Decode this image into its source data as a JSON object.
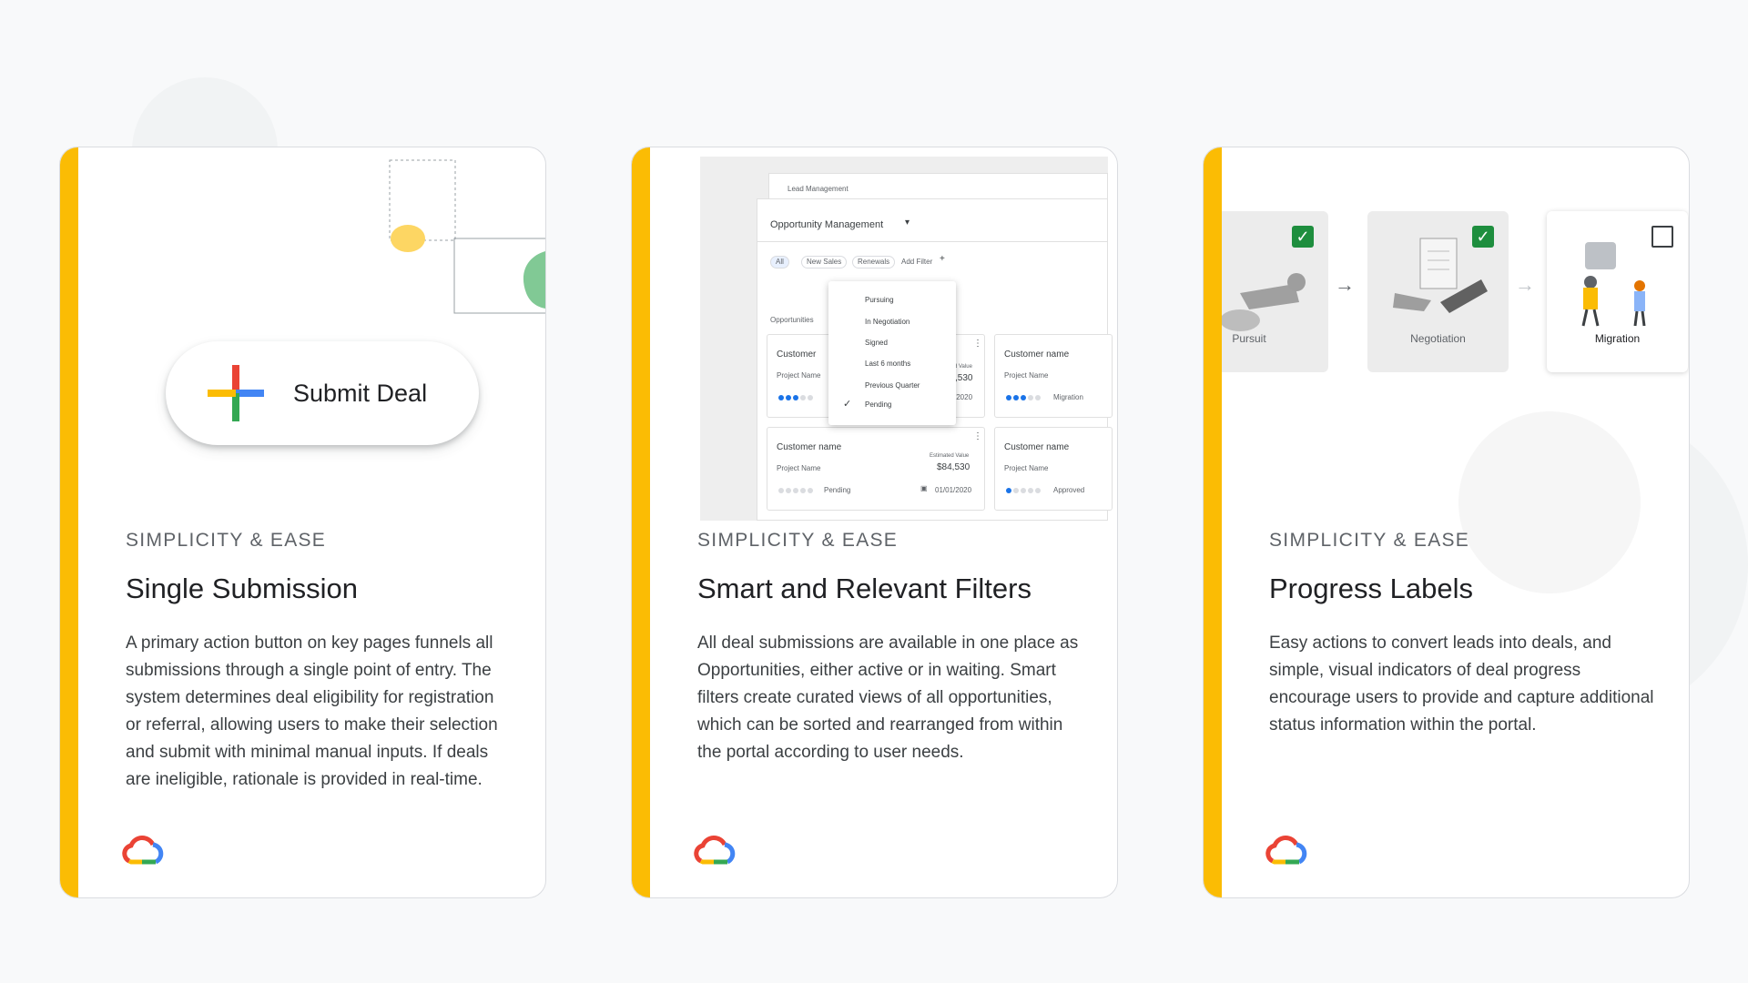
{
  "colors": {
    "accent_bar": "#fbbc04",
    "background": "#f8f9fa",
    "google_blue": "#4285f4",
    "google_red": "#ea4335",
    "google_yellow": "#fbbc04",
    "google_green": "#34a853",
    "check_green": "#1e8e3e"
  },
  "cards": [
    {
      "eyebrow": "SIMPLICITY & EASE",
      "title": "Single Submission",
      "body": "A primary action button on key pages funnels all submissions through a single point of entry. The system determines deal eligibility for registration or referral, allowing users to make their selection and submit with minimal manual inputs. If deals are ineligible, rationale is provided in real-time.",
      "logo_icon": "google-cloud-logo-icon",
      "illustration": {
        "fab_label": "Submit Deal",
        "fab_icon": "plus-icon"
      }
    },
    {
      "eyebrow": "SIMPLICITY & EASE",
      "title": "Smart and Relevant Filters",
      "body": "All deal submissions are available in one place as Opportunities, either active or in waiting. Smart filters create curated views of all opportunities, which can be sorted and rearranged from within the portal according to user needs.",
      "logo_icon": "google-cloud-logo-icon",
      "illustration": {
        "back_window_title": "Lead Management",
        "dropdown_label": "Opportunity Management",
        "chips": [
          "All",
          "New Sales",
          "Renewals",
          "Add Filter"
        ],
        "section_label": "Opportunities",
        "filter_menu": [
          "Pursuing",
          "In Negotiation",
          "Signed",
          "Last 6 months",
          "Previous Quarter",
          "Pending"
        ],
        "filter_menu_checked": "Pending",
        "opportunity_cards": [
          {
            "customer": "Customer",
            "project": "Project Name",
            "value_label": "d Value",
            "value": ",530",
            "date": "/2020",
            "status": "",
            "progress": 3
          },
          {
            "customer": "Customer name",
            "project": "Project Name",
            "value_label": "",
            "value": "",
            "date": "",
            "status": "Migration",
            "progress": 3
          },
          {
            "customer": "Customer name",
            "project": "Project Name",
            "value_label": "Estimated Value",
            "value": "$84,530",
            "date": "01/01/2020",
            "status": "Pending",
            "progress": 0
          },
          {
            "customer": "Customer name",
            "project": "Project Name",
            "value_label": "",
            "value": "",
            "date": "",
            "status": "Approved",
            "progress": 1
          }
        ]
      }
    },
    {
      "eyebrow": "SIMPLICITY & EASE",
      "title": "Progress Labels",
      "body": "Easy actions to convert leads into deals, and simple, visual indicators of deal progress encourage users to provide and capture additional status information within the portal.",
      "logo_icon": "google-cloud-logo-icon",
      "illustration": {
        "steps": [
          {
            "label": "Pursuit",
            "checked": true
          },
          {
            "label": "Negotiation",
            "checked": true
          },
          {
            "label": "Migration",
            "checked": false
          }
        ]
      }
    }
  ]
}
